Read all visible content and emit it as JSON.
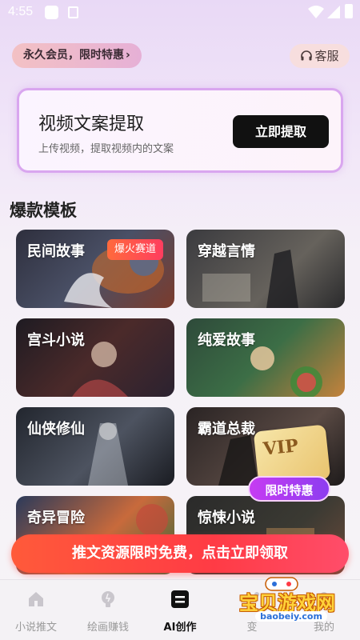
{
  "status_bar": {
    "time": "4:55"
  },
  "header": {
    "vip_pill": "永久会员，限时特惠",
    "vip_chevron": "›",
    "service": "客服"
  },
  "extract_card": {
    "title": "视频文案提取",
    "subtitle": "上传视频，提取视频内的文案",
    "button": "立即提取"
  },
  "section_title": "爆款模板",
  "templates": [
    {
      "label": "民间故事",
      "badge": "爆火赛道"
    },
    {
      "label": "穿越言情"
    },
    {
      "label": "宫斗小说"
    },
    {
      "label": "纯爱故事"
    },
    {
      "label": "仙侠修仙"
    },
    {
      "label": "霸道总裁"
    },
    {
      "label": "奇异冒险"
    },
    {
      "label": "惊悚小说"
    }
  ],
  "vip_float": {
    "ticket": "VIP",
    "flag": "限时特惠"
  },
  "promo_banner": "推文资源限时免费，点击立即领取",
  "bottom_nav": [
    {
      "label": "小说推文",
      "icon": "home-icon"
    },
    {
      "label": "绘画赚钱",
      "icon": "bulb-icon"
    },
    {
      "label": "AI创作",
      "icon": "ai-create-icon",
      "active": true
    },
    {
      "label": "变",
      "icon": "wand-icon"
    },
    {
      "label": "我的",
      "icon": "user-icon"
    }
  ],
  "watermark": {
    "text": "宝贝游戏网",
    "url": "baobeiy.com"
  },
  "colors": {
    "accent": "#111111",
    "promo": "#ff3b45",
    "vip_purple": "#a63df0"
  }
}
